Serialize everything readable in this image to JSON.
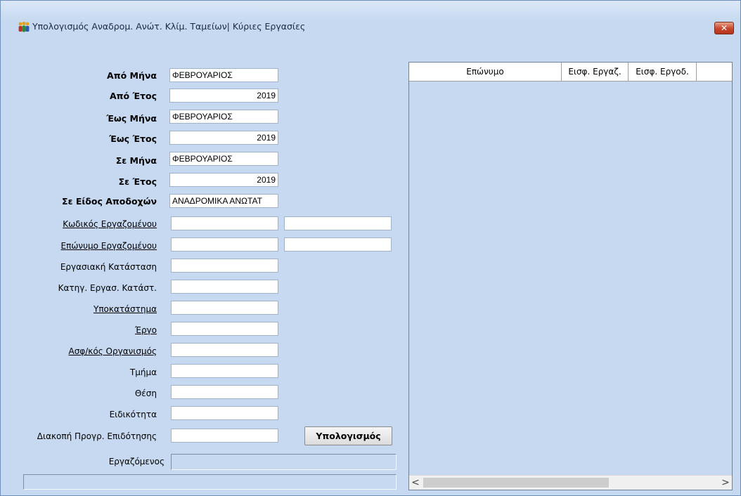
{
  "window": {
    "title": "Υπολογισμός Αναδρομ. Ανώτ. Κλίμ. Ταμείων| Κύριες Εργασίες",
    "close_label": "✕",
    "icon": "people-group-icon"
  },
  "form": {
    "from_month_label": "Από Μήνα",
    "from_month_value": "ΦΕΒΡΟΥΑΡΙΟΣ",
    "from_year_label": "Από Έτος",
    "from_year_value": "2019",
    "to_month_label": "Έως Μήνα",
    "to_month_value": "ΦΕΒΡΟΥΑΡΙΟΣ",
    "to_year_label": "Έως Έτος",
    "to_year_value": "2019",
    "in_month_label": "Σε Μήνα",
    "in_month_value": "ΦΕΒΡΟΥΑΡΙΟΣ",
    "in_year_label": "Σε Έτος",
    "in_year_value": "2019",
    "earnings_type_label": "Σε Είδος Αποδοχών",
    "earnings_type_value": "ΑΝΑΔΡΟΜΙΚΑ ΑΝΩΤΑΤ",
    "employee_code_label": "Κωδικός Εργαζομένου",
    "employee_code_from": "",
    "employee_code_to": "",
    "employee_surname_label": "Επώνυμο Εργαζομένου",
    "employee_surname_from": "",
    "employee_surname_to": "",
    "employment_status_label": "Εργασιακή Κατάσταση",
    "employment_status_value": "",
    "employment_status_category_label": "Κατηγ. Εργασ. Κατάστ.",
    "employment_status_category_value": "",
    "branch_label": "Υποκατάστημα",
    "branch_value": "",
    "project_label": "Έργο",
    "project_value": "",
    "insurance_org_label": "Ασφ/κός Οργανισμός",
    "insurance_org_value": "",
    "department_label": "Τμήμα",
    "department_value": "",
    "position_label": "Θέση",
    "position_value": "",
    "specialty_label": "Ειδικότητα",
    "specialty_value": "",
    "subsidy_stop_label": "Διακοπή Προγρ. Επιδότησης",
    "subsidy_stop_value": "",
    "calculate_label": "Υπολογισμός",
    "current_employee_label": "Εργαζόμενος",
    "current_employee_value": "",
    "status_text": ""
  },
  "grid": {
    "columns": [
      "Επώνυμο",
      "Εισφ. Εργαζ.",
      "Εισφ. Εργοδ.",
      ""
    ],
    "rows": [],
    "scroll_left": "<",
    "scroll_right": ">"
  },
  "colors": {
    "window_bg": "#c6d9f0",
    "close_button": "#c8452a"
  }
}
